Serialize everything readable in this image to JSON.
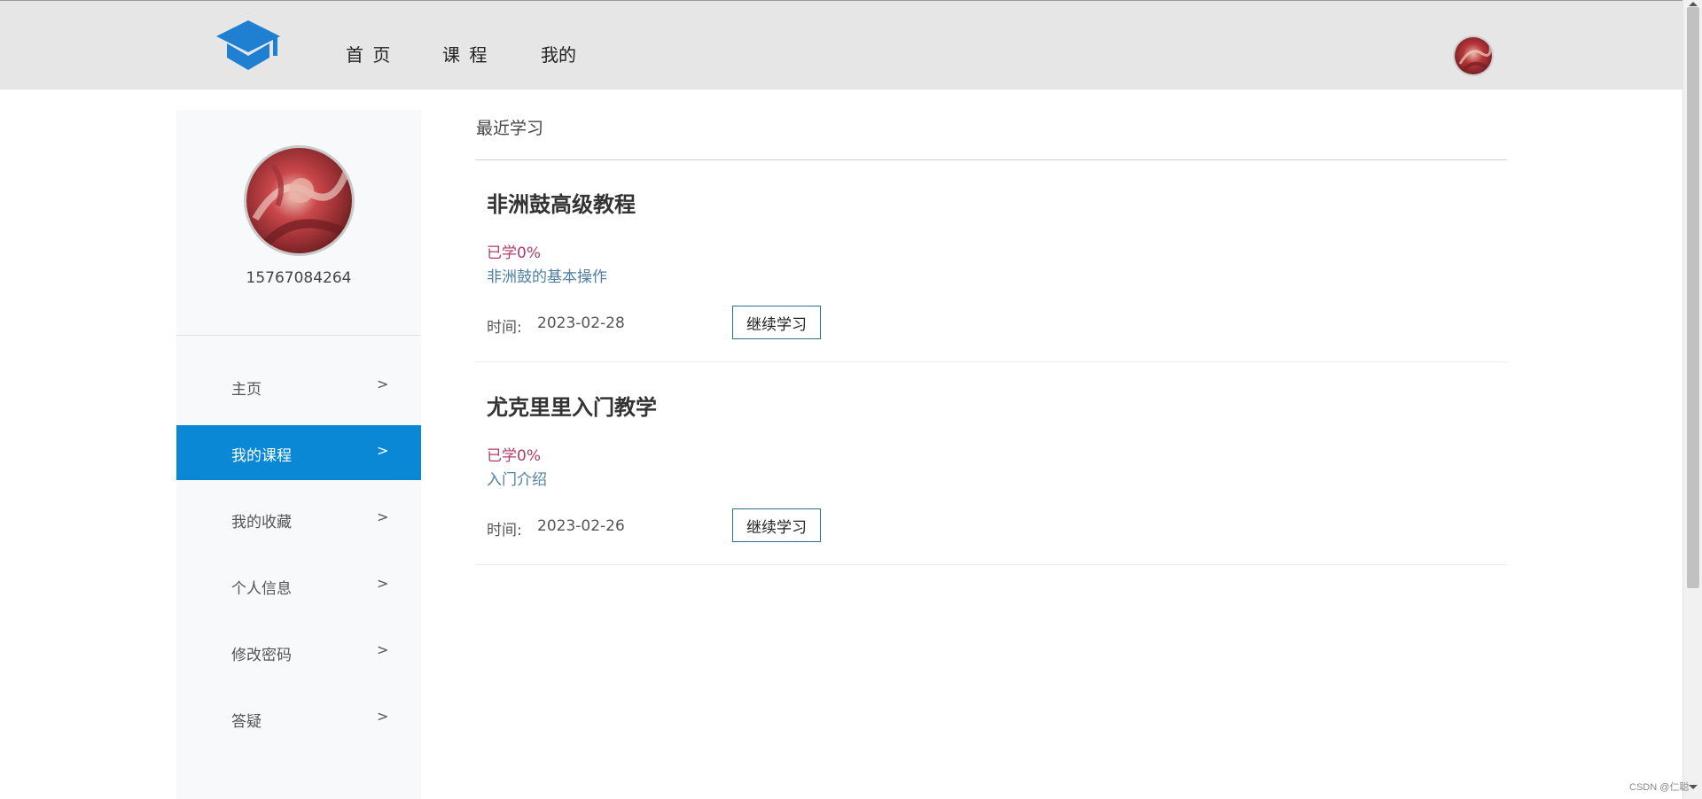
{
  "nav": {
    "home_label": "首 页",
    "course_label": "课 程",
    "mine_label": "我的",
    "logo_icon": "graduation-cap-icon",
    "brand_color": "#1f7fd0"
  },
  "profile": {
    "phone": "15767084264"
  },
  "sidebar": {
    "active_color": "#0a88d6",
    "items": [
      {
        "label": "主页",
        "chevron": ">"
      },
      {
        "label": "我的课程",
        "chevron": ">"
      },
      {
        "label": "我的收藏",
        "chevron": ">"
      },
      {
        "label": "个人信息",
        "chevron": ">"
      },
      {
        "label": "修改密码",
        "chevron": ">"
      },
      {
        "label": "答疑",
        "chevron": ">"
      }
    ]
  },
  "main": {
    "section_title": "最近学习",
    "courses": [
      {
        "title": "非洲鼓高级教程",
        "progress": "已学0%",
        "lesson": "非洲鼓的基本操作",
        "time_label": "时间:",
        "time_value": "2023-02-28",
        "button_label": "继续学习"
      },
      {
        "title": "尤克里里入门教学",
        "progress": "已学0%",
        "lesson": "入门介绍",
        "time_label": "时间:",
        "time_value": "2023-02-26",
        "button_label": "继续学习"
      }
    ]
  },
  "watermark": "CSDN @仁聪"
}
